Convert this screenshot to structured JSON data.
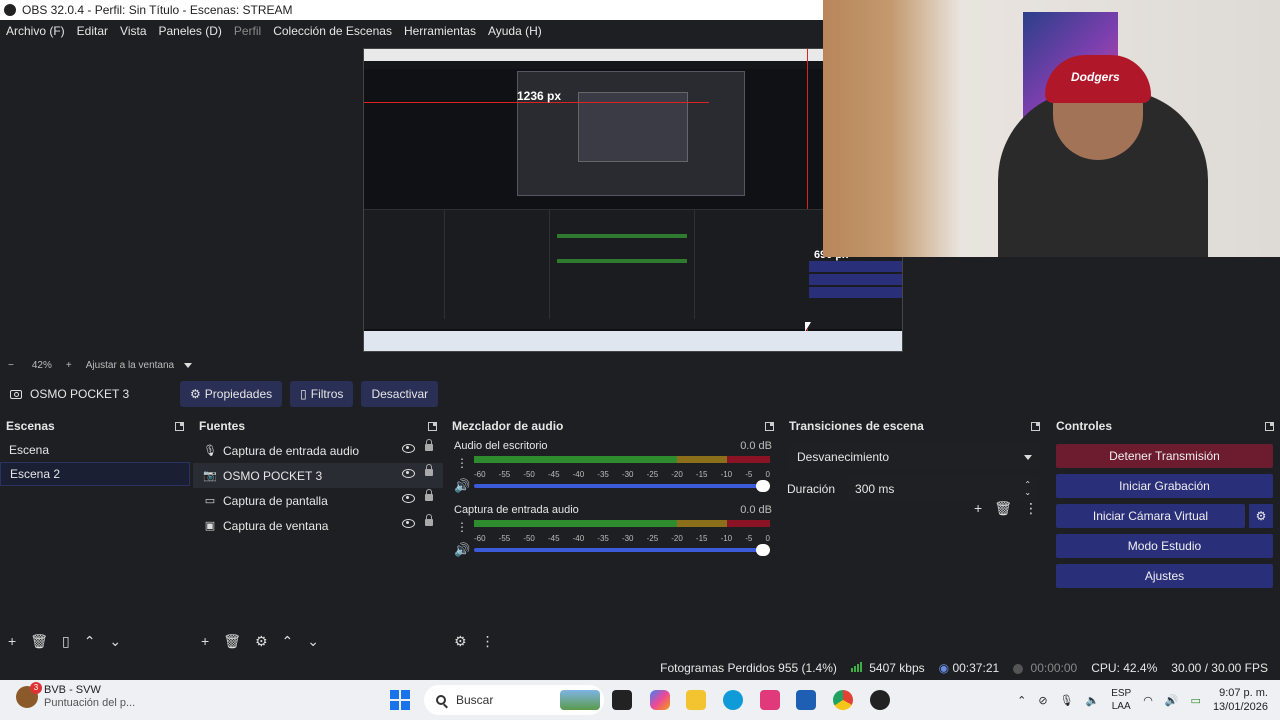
{
  "window": {
    "title": "OBS 32.0.4 - Perfil: Sin Título - Escenas: STREAM"
  },
  "menu": [
    {
      "label": "Archivo (F)",
      "enabled": true
    },
    {
      "label": "Editar",
      "enabled": true
    },
    {
      "label": "Vista",
      "enabled": true
    },
    {
      "label": "Paneles (D)",
      "enabled": true
    },
    {
      "label": "Perfil",
      "enabled": false
    },
    {
      "label": "Colección de Escenas",
      "enabled": true
    },
    {
      "label": "Herramientas",
      "enabled": true
    },
    {
      "label": "Ayuda (H)",
      "enabled": true
    }
  ],
  "preview": {
    "width_label": "1236 px",
    "height_label": "690 px",
    "zoom_minus": "−",
    "zoom": "42%",
    "zoom_plus": "+",
    "fit_label": "Ajustar a la ventana",
    "webcam_cap_text": "Dodgers"
  },
  "source_toolbar": {
    "source_name": "OSMO POCKET 3",
    "properties": "Propiedades",
    "filters": "Filtros",
    "deactivate": "Desactivar"
  },
  "scenes": {
    "title": "Escenas",
    "items": [
      {
        "label": "Escena"
      },
      {
        "label": "Escena 2",
        "selected": true
      }
    ]
  },
  "sources": {
    "title": "Fuentes",
    "items": [
      {
        "label": "Captura de entrada audio",
        "icon": "microphone-icon"
      },
      {
        "label": "OSMO POCKET 3",
        "icon": "camera-icon",
        "selected": true
      },
      {
        "label": "Captura de pantalla",
        "icon": "monitor-icon"
      },
      {
        "label": "Captura de ventana",
        "icon": "window-icon"
      }
    ]
  },
  "mixer": {
    "title": "Mezclador de audio",
    "channels": [
      {
        "name": "Audio del escritorio",
        "db": "0.0 dB",
        "level": 1.0
      },
      {
        "name": "Captura de entrada audio",
        "db": "0.0 dB",
        "level": 1.0
      }
    ],
    "ticks": [
      "-60",
      "-55",
      "-50",
      "-45",
      "-40",
      "-35",
      "-30",
      "-25",
      "-20",
      "-15",
      "-10",
      "-5",
      "0"
    ]
  },
  "transitions": {
    "title": "Transiciones de escena",
    "selected": "Desvanecimiento",
    "duration_label": "Duración",
    "duration_value": "300 ms"
  },
  "controls": {
    "title": "Controles",
    "stop_stream": "Detener Transmisión",
    "start_recording": "Iniciar Grabación",
    "start_virtual_cam": "Iniciar Cámara Virtual",
    "studio_mode": "Modo Estudio",
    "settings": "Ajustes"
  },
  "status": {
    "dropped_frames": "Fotogramas Perdidos 955 (1.4%)",
    "bitrate": "5407 kbps",
    "stream_time": "00:37:21",
    "record_time": "00:00:00",
    "cpu": "CPU: 42.4%",
    "fps": "30.00 / 30.00 FPS"
  },
  "taskbar": {
    "weather_title": "BVB - SVW",
    "weather_sub": "Puntuación del p...",
    "weather_badge": "3",
    "search_placeholder": "Buscar",
    "lang_top": "ESP",
    "lang_bottom": "LAA",
    "time": "9:07 p. m.",
    "date": "13/01/2026"
  },
  "colors": {
    "accent_button": "#2a2f7a",
    "stop_button": "#6d1b2f",
    "meter_green": "#2e8b2e",
    "meter_yellow": "#b08a1c",
    "meter_red": "#a3142b"
  }
}
